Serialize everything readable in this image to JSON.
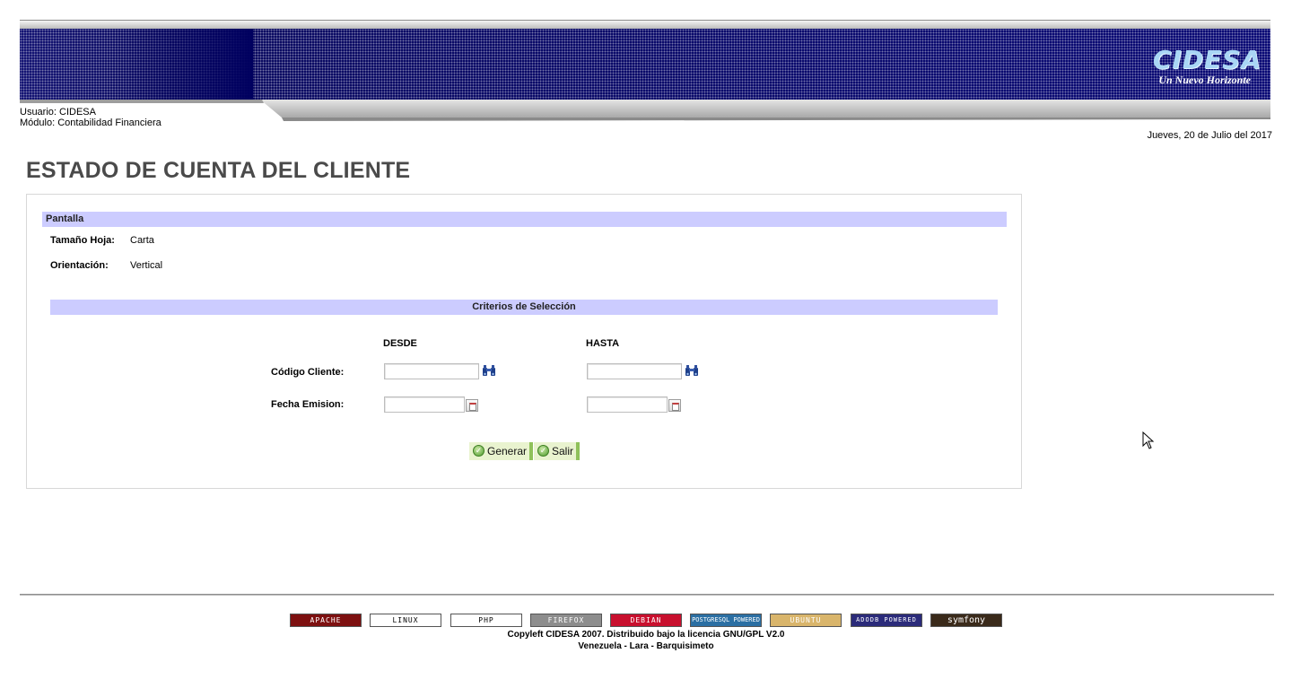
{
  "header": {
    "logo_word": "CIDESA",
    "logo_tagline": "Un Nuevo Horizonte",
    "user_line": "Usuario: CIDESA",
    "module_line": "Módulo: Contabilidad Financiera",
    "date": "Jueves, 20 de Julio del 2017",
    "colors": {
      "banner": "#000061",
      "section": "#ccccff",
      "button_accent": "#8fc15a"
    }
  },
  "page": {
    "title": "ESTADO DE CUENTA DEL CLIENTE"
  },
  "pantalla": {
    "heading": "Pantalla",
    "sheet_size_label": "Tamaño Hoja:",
    "sheet_size_value": "Carta",
    "orientation_label": "Orientación:",
    "orientation_value": "Vertical"
  },
  "criteria": {
    "heading": "Criterios de Selección",
    "from_header": "DESDE",
    "to_header": "HASTA",
    "rows": [
      {
        "label": "Código Cliente:",
        "from_value": "",
        "to_value": "",
        "picker": "binoculars-icon"
      },
      {
        "label": "Fecha Emision:",
        "from_value": "",
        "to_value": "",
        "picker": "calendar-icon"
      }
    ]
  },
  "actions": {
    "generate": "Generar",
    "exit": "Salir"
  },
  "footer": {
    "badges": [
      {
        "text": "APACHE",
        "bg": "#7d1010",
        "fg": "#ffffff"
      },
      {
        "text": "LINUX",
        "bg": "#ffffff",
        "fg": "#000000"
      },
      {
        "text": "PHP",
        "bg": "#ffffff",
        "fg": "#000000"
      },
      {
        "text": "FIREFOX",
        "bg": "#8d8d8d",
        "fg": "#ffffff"
      },
      {
        "text": "DEBIAN",
        "bg": "#c8102e",
        "fg": "#ffffff"
      },
      {
        "text": "POSTGRESQL POWERED",
        "bg": "#2b6fa3",
        "fg": "#ffffff"
      },
      {
        "text": "UBUNTU",
        "bg": "#d9b56b",
        "fg": "#ffffff"
      },
      {
        "text": "ADODB POWERED",
        "bg": "#2b2b7a",
        "fg": "#ffffff"
      },
      {
        "text": "symfony",
        "bg": "#3a2a1a",
        "fg": "#ffffff"
      }
    ],
    "copyright": "Copyleft CIDESA 2007. Distribuido bajo la licencia GNU/GPL V2.0",
    "location": "Venezuela - Lara - Barquisimeto"
  }
}
